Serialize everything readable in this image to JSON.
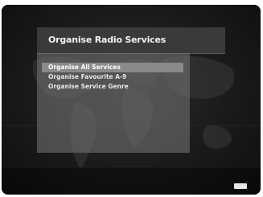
{
  "title": "Organise Radio Services",
  "menu": {
    "items": [
      {
        "label": "Organise All Services",
        "selected": true
      },
      {
        "label": "Organise Favourite A-9",
        "selected": false
      },
      {
        "label": "Organise Service Genre",
        "selected": false
      }
    ]
  },
  "colors": {
    "screen_bg": "#141414",
    "title_panel": "#3a3a3a",
    "highlight": "#8a8a8a",
    "text": "#f2f2f2"
  },
  "icons": {
    "exit_key": "exit-key-icon"
  }
}
